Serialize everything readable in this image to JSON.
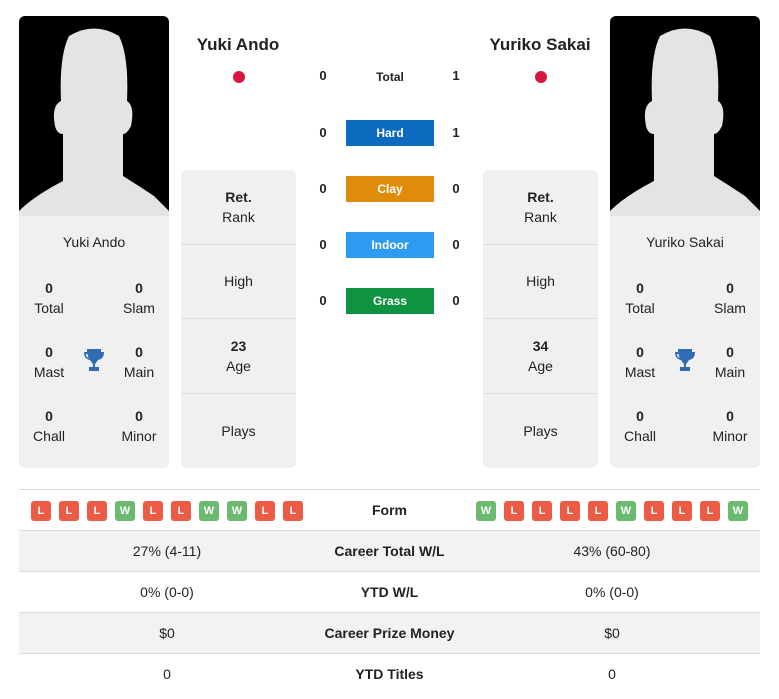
{
  "left_player": {
    "name": "Yuki Ando",
    "flag_color": "#d5173b",
    "stats": {
      "total": "0",
      "total_label": "Total",
      "slam": "0",
      "slam_label": "Slam",
      "mast": "0",
      "mast_label": "Mast",
      "main": "0",
      "main_label": "Main",
      "chall": "0",
      "chall_label": "Chall",
      "minor": "0",
      "minor_label": "Minor"
    },
    "info": {
      "rank_value": "Ret.",
      "rank_label": "Rank",
      "high_label": "High",
      "age_value": "23",
      "age_label": "Age",
      "plays_label": "Plays"
    },
    "form": [
      "L",
      "L",
      "L",
      "W",
      "L",
      "L",
      "W",
      "W",
      "L",
      "L"
    ],
    "career_total_wl": "27% (4-11)",
    "ytd_wl": "0% (0-0)",
    "career_prize_money": "$0",
    "ytd_titles": "0"
  },
  "right_player": {
    "name": "Yuriko Sakai",
    "flag_color": "#d5173b",
    "stats": {
      "total": "0",
      "total_label": "Total",
      "slam": "0",
      "slam_label": "Slam",
      "mast": "0",
      "mast_label": "Mast",
      "main": "0",
      "main_label": "Main",
      "chall": "0",
      "chall_label": "Chall",
      "minor": "0",
      "minor_label": "Minor"
    },
    "info": {
      "rank_value": "Ret.",
      "rank_label": "Rank",
      "high_label": "High",
      "age_value": "34",
      "age_label": "Age",
      "plays_label": "Plays"
    },
    "form": [
      "W",
      "L",
      "L",
      "L",
      "L",
      "W",
      "L",
      "L",
      "L",
      "W"
    ],
    "career_total_wl": "43% (60-80)",
    "ytd_wl": "0% (0-0)",
    "career_prize_money": "$0",
    "ytd_titles": "0"
  },
  "h2h": {
    "total": {
      "label": "Total",
      "left": "0",
      "right": "1"
    },
    "surfaces": [
      {
        "label": "Hard",
        "left": "0",
        "right": "1",
        "color": "#0c6bbf"
      },
      {
        "label": "Clay",
        "left": "0",
        "right": "0",
        "color": "#e08c0b"
      },
      {
        "label": "Indoor",
        "left": "0",
        "right": "0",
        "color": "#2d9cf0"
      },
      {
        "label": "Grass",
        "left": "0",
        "right": "0",
        "color": "#0e9441"
      }
    ]
  },
  "table_labels": {
    "form": "Form",
    "career_total_wl": "Career Total W/L",
    "ytd_wl": "YTD W/L",
    "career_prize_money": "Career Prize Money",
    "ytd_titles": "YTD Titles"
  }
}
